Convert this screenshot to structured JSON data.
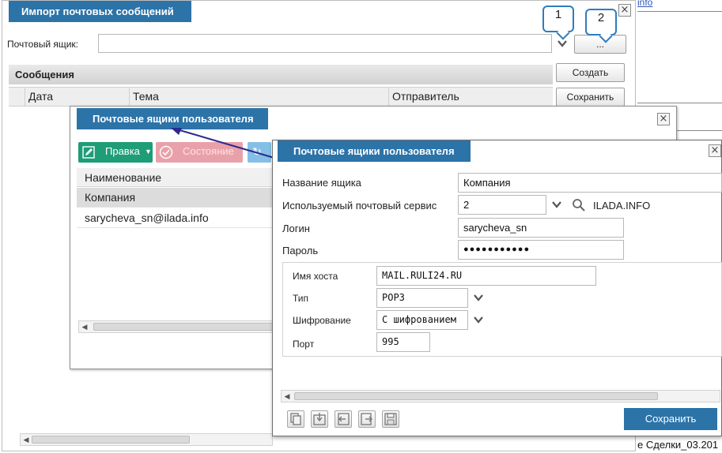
{
  "background": {
    "link_text": "info",
    "deals_text": "е Сделки_03.201"
  },
  "import_window": {
    "title": "Импорт почтовых сообщений",
    "close": "×",
    "mailbox_label": "Почтовый ящик:",
    "mailbox_value": "",
    "browse_label": "...",
    "section_title": "Сообщения",
    "columns": [
      "Дата",
      "Тема",
      "Отправитель"
    ],
    "create_label": "Создать",
    "save_label": "Сохранить",
    "callouts": [
      "1",
      "2"
    ]
  },
  "mailboxes_window": {
    "title": "Почтовые ящики пользователя",
    "close": "×",
    "toolbar": {
      "edit_label": "Правка",
      "state_label": "Состояние",
      "edit_color": "#1e9d77",
      "state_color": "#e9a1a9"
    },
    "column_header": "Наименование",
    "rows": [
      "Компания",
      "sarycheva_sn@ilada.info"
    ]
  },
  "mailbox_form": {
    "title": "Почтовые ящики пользователя",
    "close": "×",
    "fields": {
      "name_label": "Название ящика",
      "name_value": "Компания",
      "service_label": "Используемый почтовый сервис",
      "service_value": "2",
      "service_name": "ILADA.INFO",
      "login_label": "Логин",
      "login_value": "sarycheva_sn",
      "password_label": "Пароль",
      "password_value": "●●●●●●●●●●●"
    },
    "server": {
      "host_label": "Имя хоста",
      "host_value": "MAIL.RULI24.RU",
      "type_label": "Тип",
      "type_value": "POP3",
      "encryption_label": "Шифрование",
      "encryption_value": "С шифрованием",
      "port_label": "Порт",
      "port_value": "995"
    },
    "bottom_icons": [
      "copy-icon",
      "import-icon",
      "back-icon",
      "export-icon",
      "save-disk-icon"
    ],
    "save_label": "Сохранить",
    "accent_color": "#2c73a8"
  }
}
